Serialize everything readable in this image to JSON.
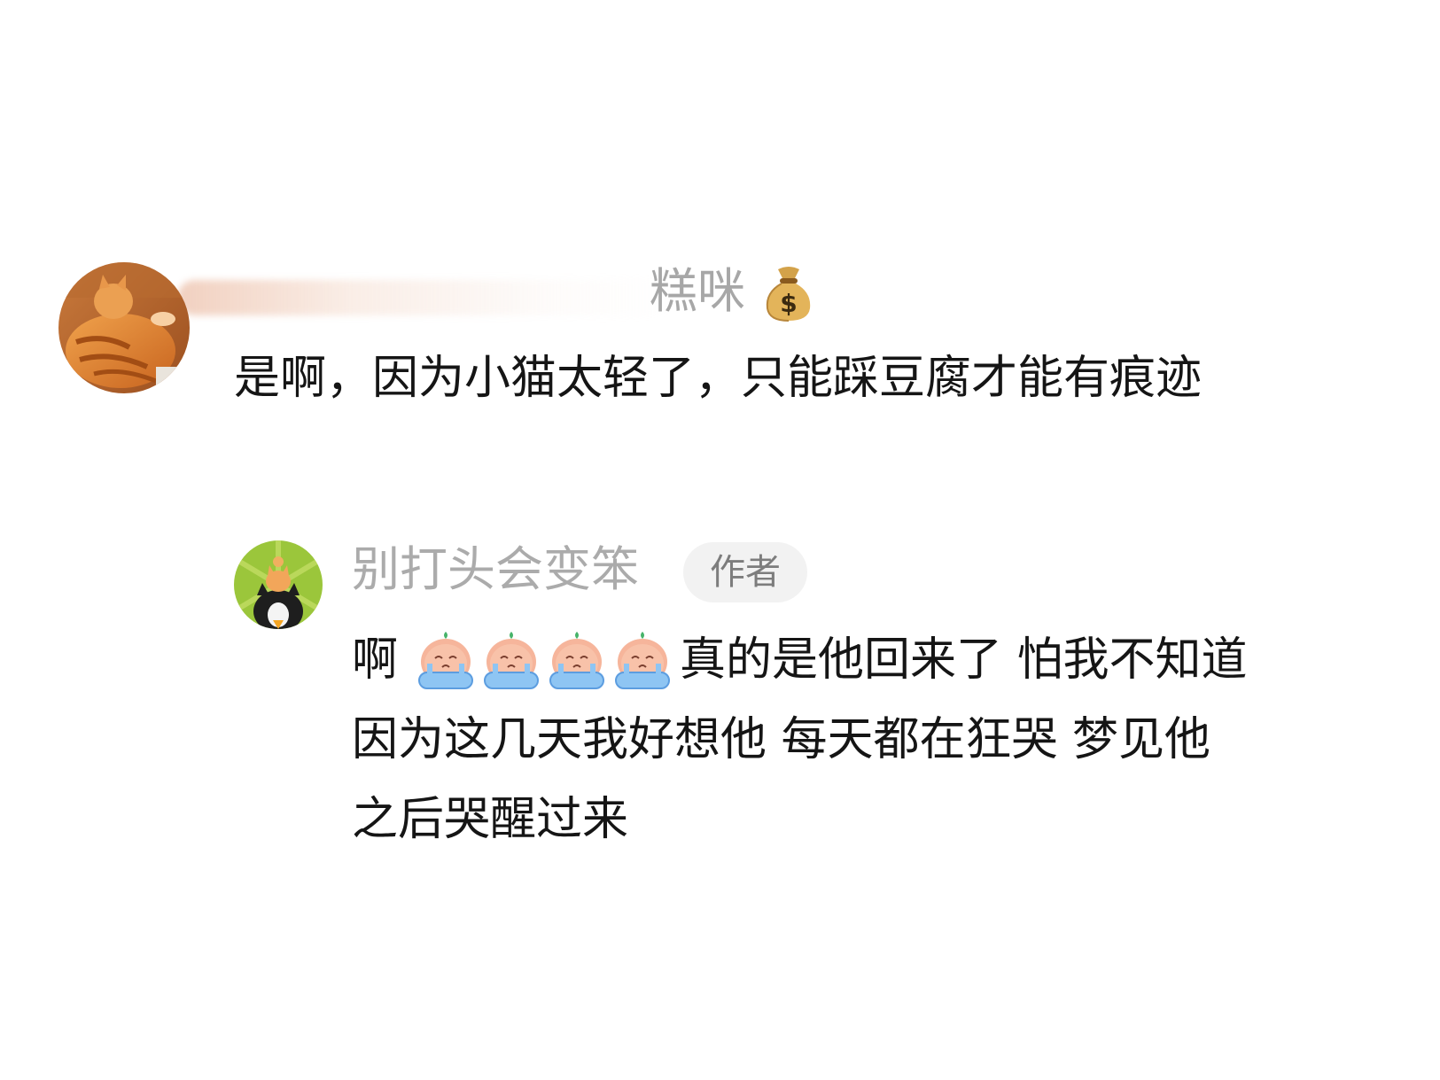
{
  "comments": [
    {
      "username": "糕咪",
      "username_badge_icon": "money-bag-icon",
      "avatar_icon": "orange-cat-avatar-icon",
      "text": "是啊，因为小猫太轻了，只能踩豆腐才能有痕迹"
    },
    {
      "username": "别打头会变笨",
      "author_tag": "作者",
      "avatar_icon": "dog-and-cat-avatar-icon",
      "lines": [
        {
          "prefix": "啊",
          "emojis": [
            "crying-face-emoji",
            "crying-face-emoji",
            "crying-face-emoji",
            "crying-face-emoji"
          ],
          "suffix": "真的是他回来了  怕我不知道"
        },
        {
          "text": "因为这几天我好想他 每天都在狂哭 梦见他"
        },
        {
          "text": "之后哭醒过来"
        }
      ]
    }
  ],
  "colors": {
    "background": "#ffffff",
    "username": "#a7a7a7",
    "body_text": "#151515",
    "author_tag_bg": "#f2f2f2",
    "author_tag_text": "#7d7d7d"
  }
}
